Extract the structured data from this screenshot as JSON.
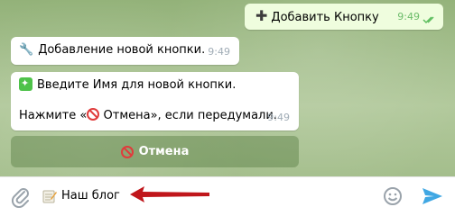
{
  "messages": {
    "outgoing": {
      "text": "Добавить Кнопку",
      "time": "9:49"
    },
    "incoming1": {
      "text": "Добавление новой кнопки.",
      "time": "9:49"
    },
    "incoming2": {
      "line1": "Введите Имя для новой кнопки.",
      "line2_pre": "Нажмите «",
      "line2_cancel": " Отмена",
      "line2_post": "», если передумали.",
      "time": "9:49"
    }
  },
  "keyboard": {
    "cancel_label": "Отмена"
  },
  "composer": {
    "input_value": "Наш блог"
  },
  "icons": {
    "attach": "paperclip-icon",
    "memo": "memo-icon",
    "arrow": "red-arrow-icon",
    "emoji": "smile-icon",
    "send": "send-icon"
  },
  "colors": {
    "accent": "#40a7e3",
    "arrow": "#c0161b",
    "outgoing_bubble": "#effdde"
  }
}
